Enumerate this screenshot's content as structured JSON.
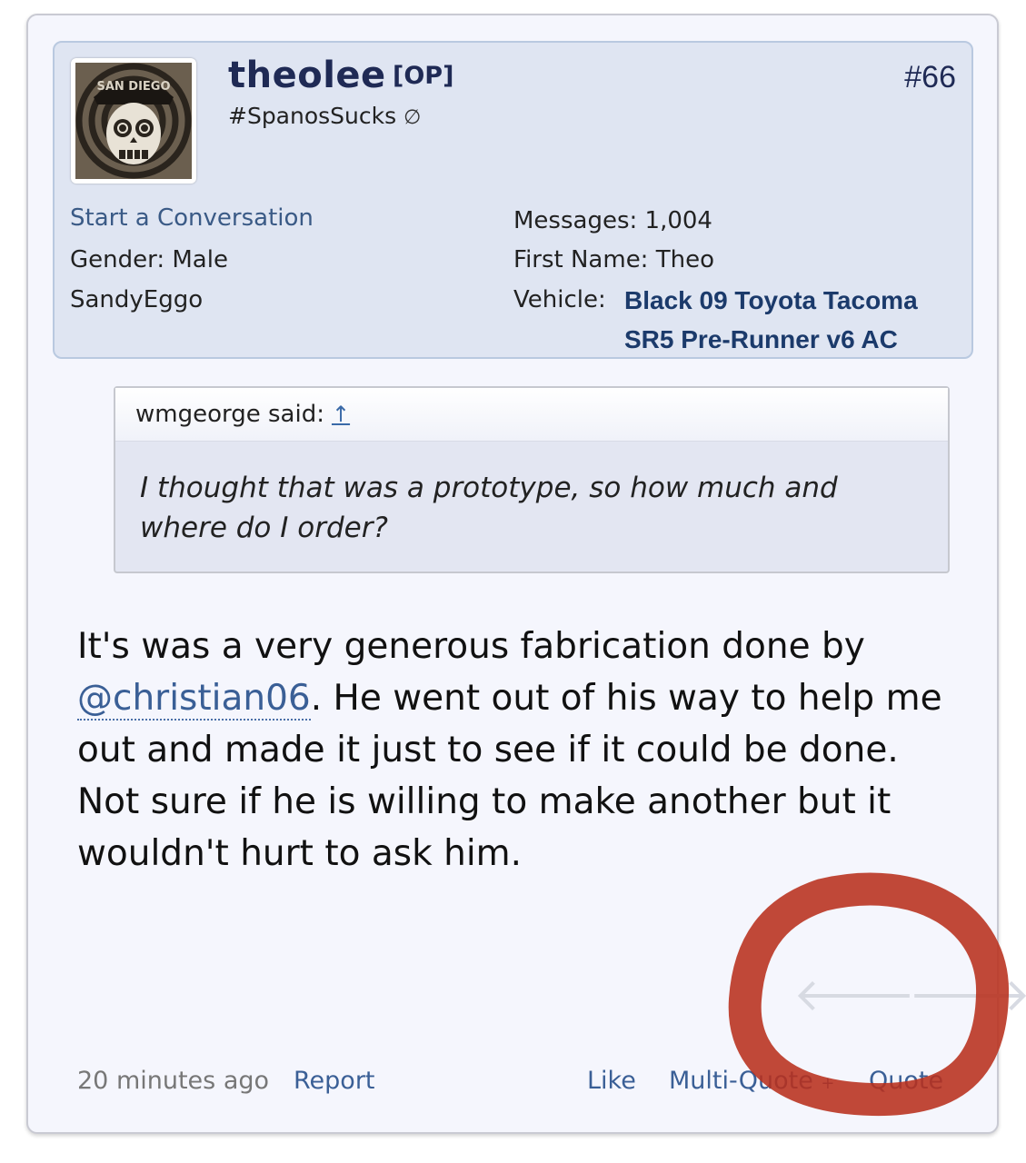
{
  "post": {
    "username": "theolee",
    "op_tag": "[OP]",
    "post_number": "#66",
    "user_title": "#SpanosSucks",
    "user_title_icon": "null-symbol-icon",
    "start_conversation": "Start a Conversation",
    "gender": "Gender:  Male",
    "location": "SandyEggo",
    "messages": "Messages:  1,004",
    "first_name": "First Name:  Theo",
    "vehicle_label": "Vehicle:",
    "vehicle_line1": "Black 09 Toyota Tacoma",
    "vehicle_line2": "SR5 Pre-Runner v6 AC",
    "avatar_text": "SAN DIEGO"
  },
  "quote": {
    "attribution": "wmgeorge said:",
    "up_link": "↑",
    "text": "I thought that was a prototype, so how much and where do I order?"
  },
  "message": {
    "part1": "It's was a very generous fabrication done by ",
    "mention": "@christian06",
    "part2": ". He went out of his way to help me out and made it just to see if it could be done. Not sure if he is willing to make another but it wouldn't hurt to ask him."
  },
  "footer": {
    "timestamp": "20 minutes ago",
    "report": "Report",
    "like": "Like",
    "multiquote": "Multi-Quote",
    "multiquote_plus": "+",
    "quote": "Quote"
  },
  "nav": {
    "prev": "🡐",
    "next": "🡒"
  },
  "colors": {
    "panel_bg": "#dfe5f2",
    "link": "#3a5f96",
    "annotation_circle": "#b8301c"
  }
}
